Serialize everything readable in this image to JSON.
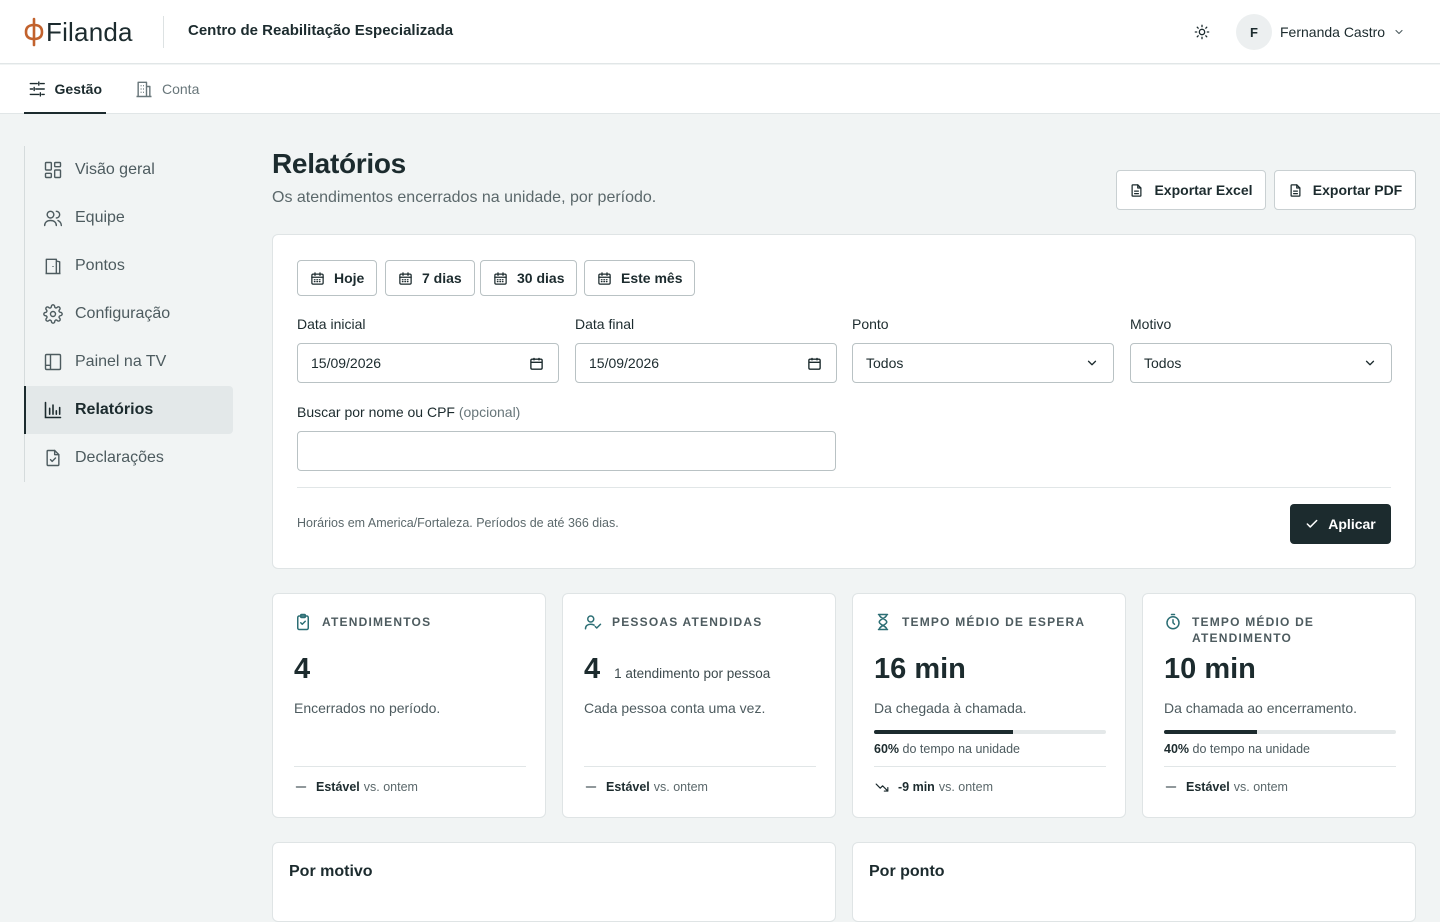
{
  "header": {
    "brand": "Filanda",
    "unit_name": "Centro de Reabilitação Especializada",
    "user_initial": "F",
    "user_name": "Fernanda Castro"
  },
  "tabs": [
    {
      "label": "Gestão",
      "icon": "sliders-icon",
      "active": true
    },
    {
      "label": "Conta",
      "icon": "building-icon",
      "active": false
    }
  ],
  "sidebar": {
    "items": [
      {
        "label": "Visão geral",
        "icon": "dashboard-grid-icon"
      },
      {
        "label": "Equipe",
        "icon": "users-icon"
      },
      {
        "label": "Pontos",
        "icon": "door-icon"
      },
      {
        "label": "Configuração",
        "icon": "gear-icon"
      },
      {
        "label": "Painel na TV",
        "icon": "panel-icon"
      },
      {
        "label": "Relatórios",
        "icon": "bar-chart-icon",
        "active": true
      },
      {
        "label": "Declarações",
        "icon": "file-check-icon"
      }
    ]
  },
  "page": {
    "title": "Relatórios",
    "subtitle": "Os atendimentos encerrados na unidade, por período.",
    "export_excel": "Exportar Excel",
    "export_pdf": "Exportar PDF"
  },
  "filters": {
    "quick_ranges": [
      "Hoje",
      "7 dias",
      "30 dias",
      "Este mês"
    ],
    "start_label": "Data inicial",
    "start_value": "15/09/2026",
    "end_label": "Data final",
    "end_value": "15/09/2026",
    "point_label": "Ponto",
    "point_value": "Todos",
    "reason_label": "Motivo",
    "reason_value": "Todos",
    "search_label": "Buscar por nome ou CPF",
    "search_optional": "(opcional)",
    "search_value": "",
    "timezone_note": "Horários em America/Fortaleza. Períodos de até 366 dias.",
    "apply_label": "Aplicar"
  },
  "kpis": [
    {
      "label": "Atendimentos",
      "icon": "clipboard-check-icon",
      "value": "4",
      "value_note": "",
      "description": "Encerrados no período.",
      "trend_strong": "Estável",
      "trend_text": "vs. ontem"
    },
    {
      "label": "Pessoas atendidas",
      "icon": "user-check-icon",
      "value": "4",
      "value_note": "1 atendimento por pessoa",
      "description": "Cada pessoa conta uma vez.",
      "trend_strong": "Estável",
      "trend_text": "vs. ontem"
    },
    {
      "label": "Tempo médio de espera",
      "icon": "hourglass-icon",
      "value": "16 min",
      "description": "Da chegada à chamada.",
      "share_fraction": 0.6,
      "share_percent": "60%",
      "share_text": "do tempo na unidade",
      "trend_strong": "-9 min",
      "trend_text": "vs. ontem"
    },
    {
      "label": "Tempo médio de atendimento",
      "icon": "timer-icon",
      "value": "10 min",
      "description": "Da chamada ao encerramento.",
      "share_fraction": 0.4,
      "share_percent": "40%",
      "share_text": "do tempo na unidade",
      "trend_strong": "Estável",
      "trend_text": "vs. ontem"
    }
  ],
  "sections": {
    "by_reason": "Por motivo",
    "by_point": "Por ponto"
  }
}
